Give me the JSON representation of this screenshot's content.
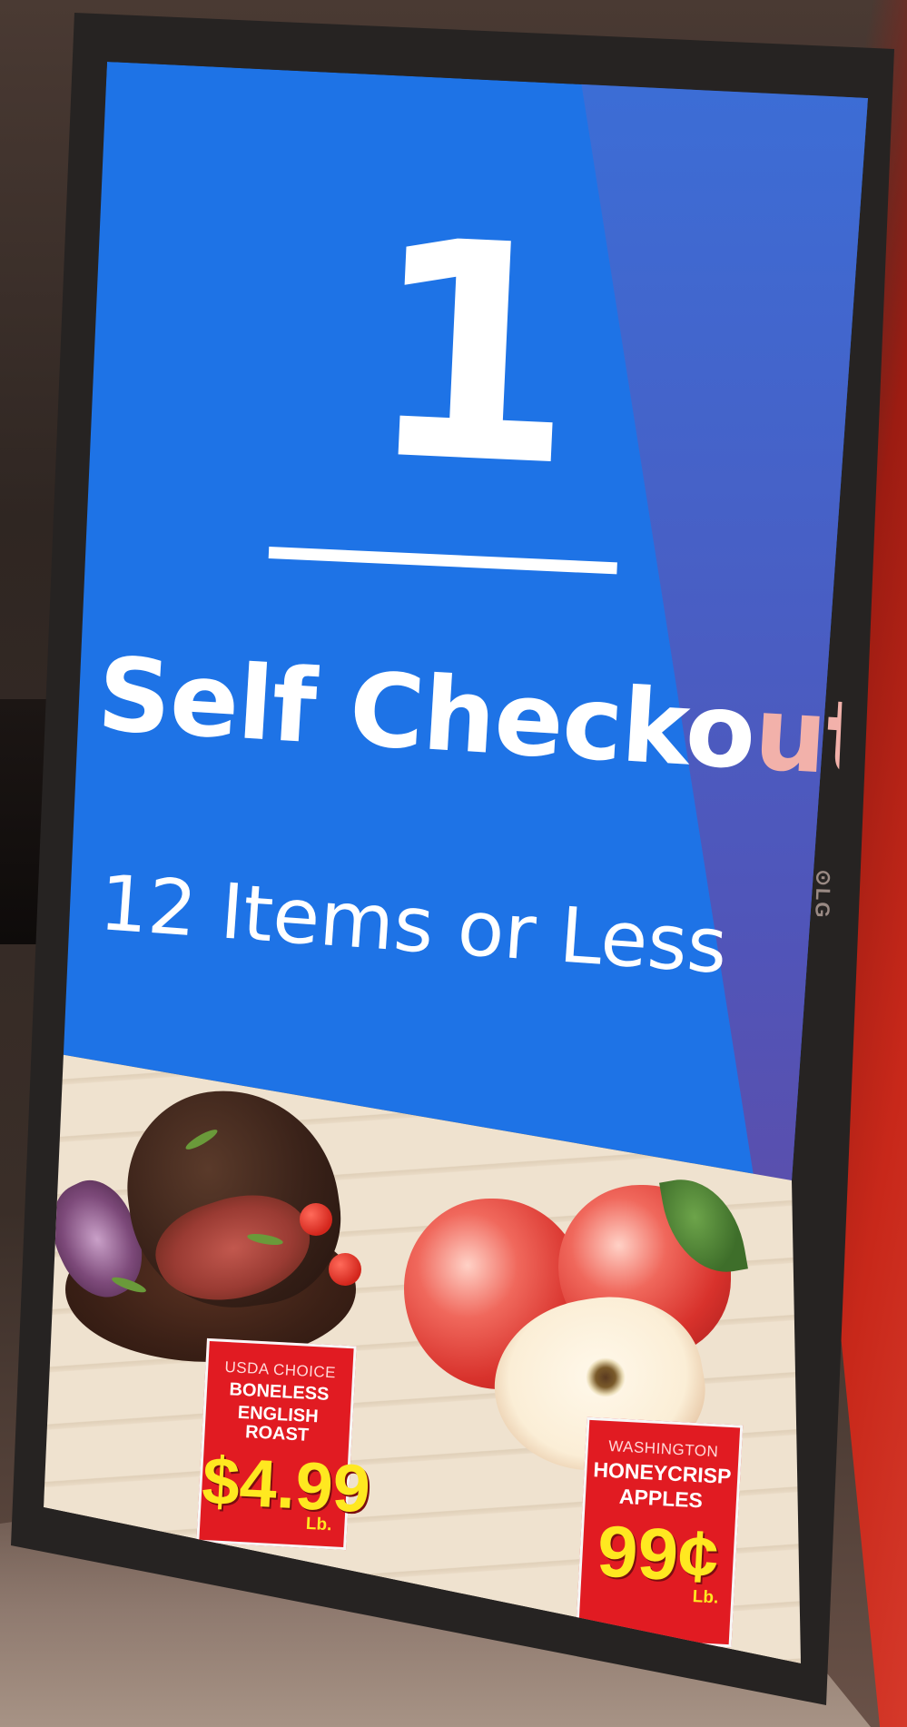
{
  "display": {
    "lane_number": "1",
    "title_main": "Self Checko",
    "title_tail": "ut",
    "subtitle": "12 Items or Less",
    "brand": "⊙LG"
  },
  "promotions": [
    {
      "sub": "USDA CHOICE",
      "name_line1": "BONELESS",
      "name_line2": "ENGLISH ROAST",
      "price": "$4.99",
      "unit": "Lb."
    },
    {
      "sub": "WASHINGTON",
      "name_line1": "HONEYCRISP",
      "name_line2": "APPLES",
      "price": "99¢",
      "unit": "Lb."
    }
  ],
  "colors": {
    "screen_blue": "#1e73e6",
    "tag_red": "#e11b22",
    "price_yellow": "#ffe820",
    "bezel": "#262322"
  }
}
